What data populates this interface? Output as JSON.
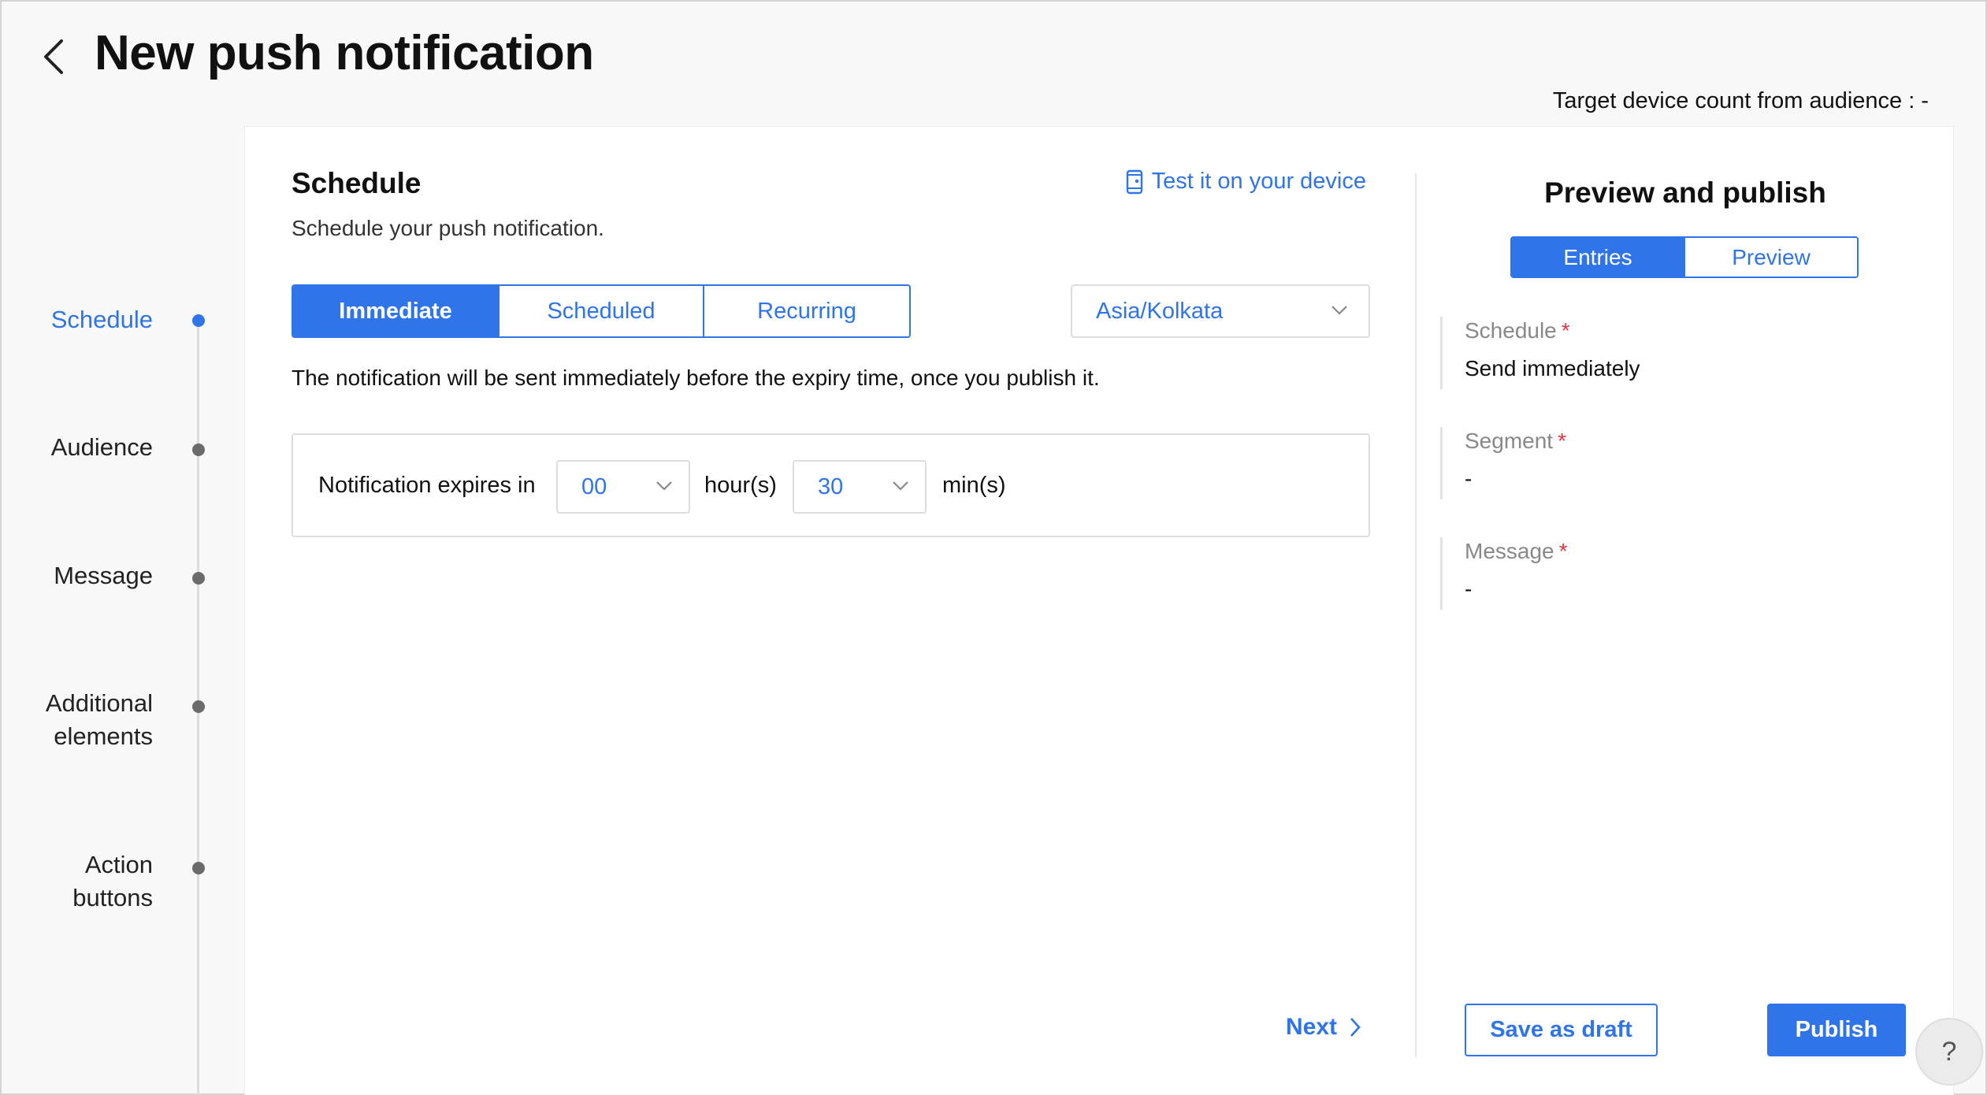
{
  "header": {
    "title": "New push notification",
    "device_count": "Target device count from audience : -"
  },
  "stepper": {
    "steps": [
      {
        "label": "Schedule",
        "active": true
      },
      {
        "label": "Audience",
        "active": false
      },
      {
        "label": "Message",
        "active": false
      },
      {
        "label": "Additional elements",
        "active": false
      },
      {
        "label": "Action buttons",
        "active": false
      }
    ]
  },
  "schedule": {
    "title": "Schedule",
    "subtitle": "Schedule your push notification.",
    "test_link": "Test it on your device",
    "tabs": [
      "Immediate",
      "Scheduled",
      "Recurring"
    ],
    "selected_tab": "Immediate",
    "timezone": "Asia/Kolkata",
    "info_text": "The notification will be sent immediately before the expiry time, once you publish it.",
    "expiry": {
      "label": "Notification expires in",
      "hours_value": "00",
      "hours_unit": "hour(s)",
      "mins_value": "30",
      "mins_unit": "min(s)"
    },
    "next_label": "Next"
  },
  "preview": {
    "title": "Preview and publish",
    "tabs": [
      "Entries",
      "Preview"
    ],
    "selected_tab": "Entries",
    "entries": [
      {
        "label": "Schedule",
        "value": "Send immediately"
      },
      {
        "label": "Segment",
        "value": "-"
      },
      {
        "label": "Message",
        "value": "-"
      }
    ],
    "required_mark": "*",
    "save_draft_label": "Save as draft",
    "publish_label": "Publish"
  },
  "help": {
    "label": "?"
  },
  "colors": {
    "accent": "#2f74e8",
    "required": "#e0383e",
    "muted": "#888888"
  }
}
